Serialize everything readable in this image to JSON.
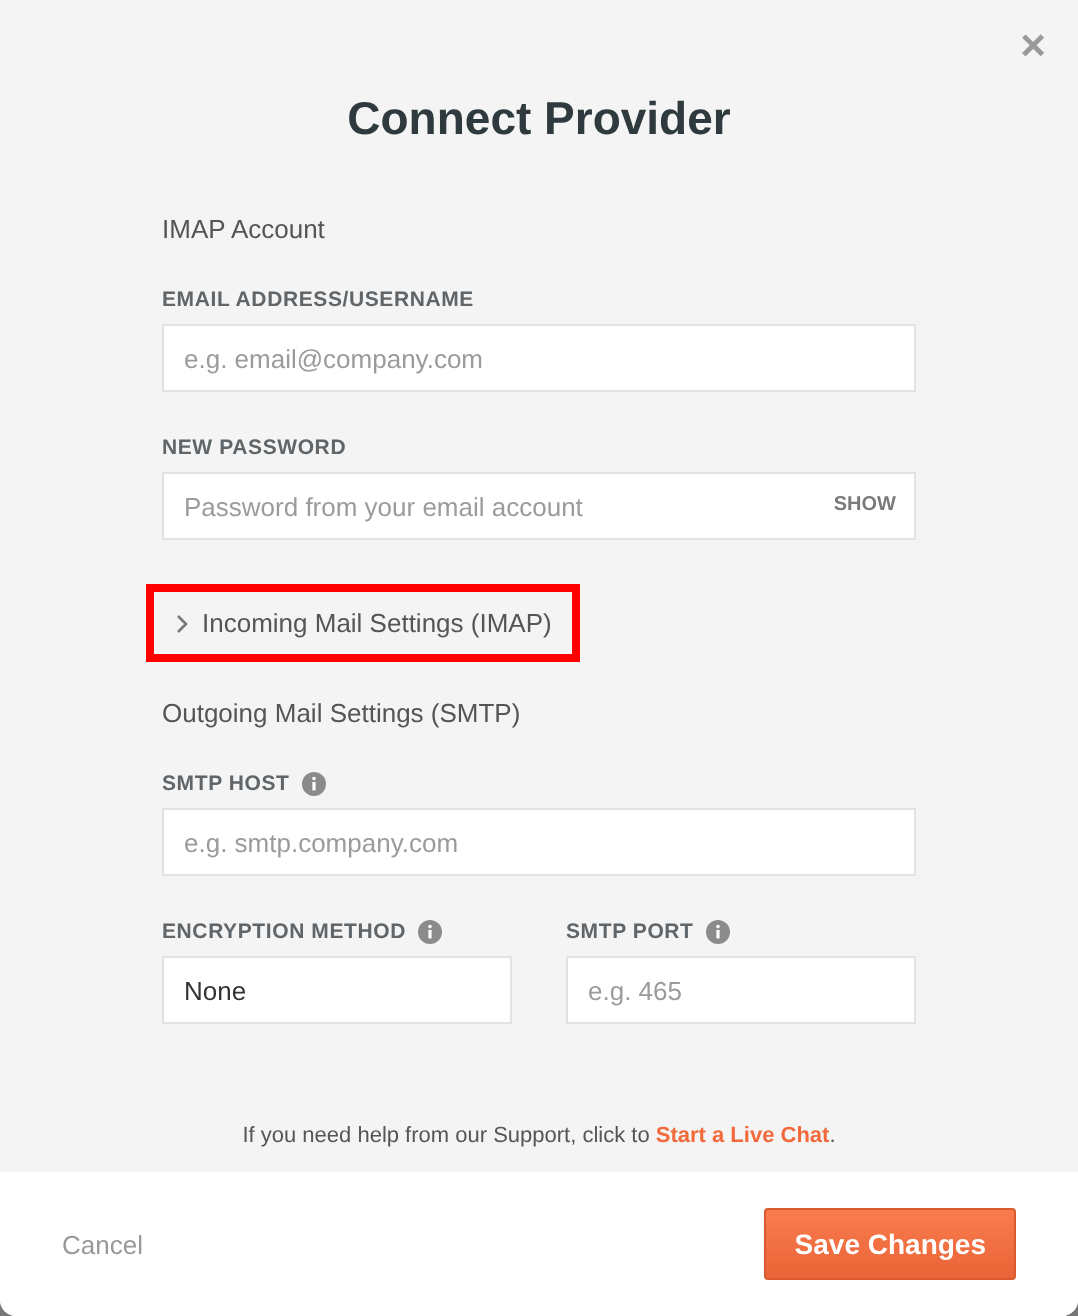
{
  "dialog": {
    "title": "Connect Provider",
    "close": "×"
  },
  "section_imap": "IMAP Account",
  "email": {
    "label": "EMAIL ADDRESS/USERNAME",
    "placeholder": "e.g. email@company.com"
  },
  "password": {
    "label": "NEW PASSWORD",
    "placeholder": "Password from your email account",
    "toggle": "SHOW"
  },
  "incoming": {
    "label": "Incoming Mail Settings (IMAP)",
    "expanded": false,
    "highlighted": true
  },
  "section_smtp": "Outgoing Mail Settings (SMTP)",
  "smtp_host": {
    "label": "SMTP HOST",
    "placeholder": "e.g. smtp.company.com"
  },
  "encryption": {
    "label": "ENCRYPTION METHOD",
    "value": "None"
  },
  "smtp_port": {
    "label": "SMTP PORT",
    "placeholder": "e.g. 465"
  },
  "help": {
    "text": "If you need help from our Support, click to ",
    "link": "Start a Live Chat",
    "end": "."
  },
  "footer": {
    "cancel": "Cancel",
    "save": "Save Changes"
  }
}
